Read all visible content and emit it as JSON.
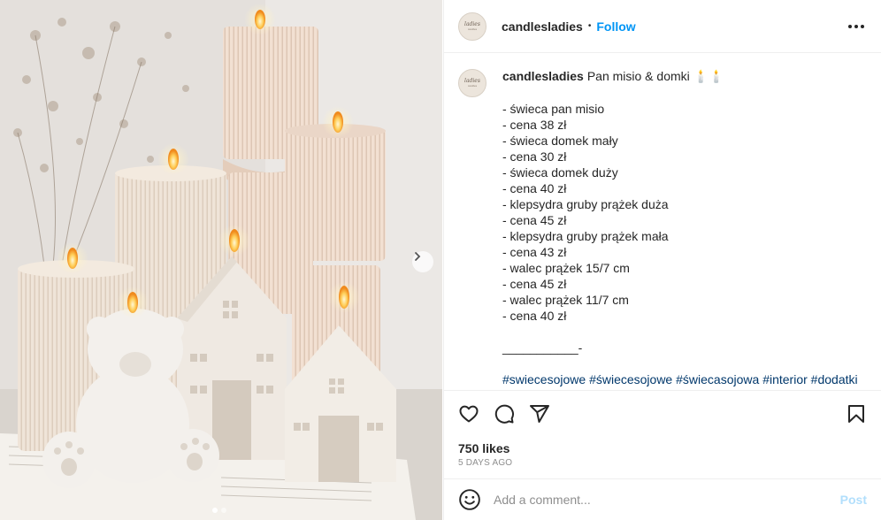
{
  "post": {
    "username": "candlesladies",
    "follow_label": "Follow",
    "separator": "•",
    "avatar_text_top": "ladies",
    "avatar_text_bottom": "candles"
  },
  "caption": {
    "username": "candlesladies",
    "title": "Pan misio & domki 🕯️🕯️",
    "lines": [
      "- świeca pan misio",
      "- cena 38 zł",
      "- świeca domek mały",
      "- cena 30 zł",
      "- świeca domek duży",
      "- cena 40 zł",
      "- klepsydra gruby prążek duża",
      "- cena 45 zł",
      "- klepsydra gruby prążek mała",
      "- cena 43 zł",
      "- walec prążek 15/7 cm",
      "- cena 45 zł",
      "- walec prążek 11/7 cm",
      "- cena 40 zł"
    ],
    "divider": "___________-",
    "hashtags": [
      "#swiecesojowe",
      "#świecesojowe",
      "#świecasojowa",
      "#interior",
      "#dodatki"
    ]
  },
  "engagement": {
    "likes": "750 likes",
    "time": "5 DAYS AGO"
  },
  "comment_box": {
    "placeholder": "Add a comment...",
    "post_label": "Post"
  },
  "icons": {
    "like": "heart-icon",
    "comment": "comment-icon",
    "share": "share-icon",
    "save": "bookmark-icon",
    "emoji": "emoji-icon",
    "more": "more-icon",
    "next": "chevron-right-icon"
  },
  "colors": {
    "accent": "#0095f6",
    "hashtag": "#00376b",
    "muted": "#8e8e8e",
    "post_disabled": "#b2dffc"
  },
  "carousel": {
    "slides": 2,
    "active": 1
  }
}
